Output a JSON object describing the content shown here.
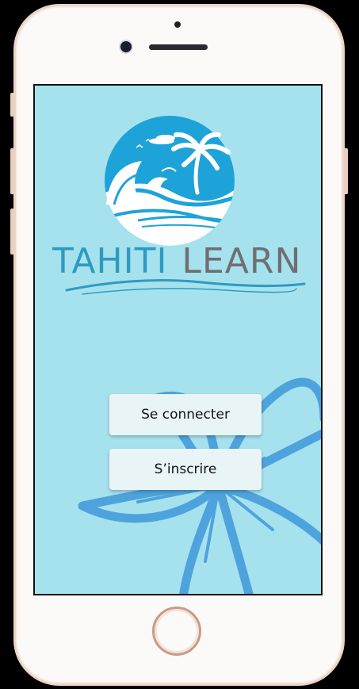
{
  "app": {
    "brand_part1": "TAHITI",
    "brand_part2": "LEARN"
  },
  "buttons": {
    "login_label": "Se connecter",
    "signup_label": "S’inscrire"
  },
  "icons": {
    "logo": "island-sea-logo-icon",
    "background": "tiare-flower-icon",
    "home": "home-button-icon"
  },
  "colors": {
    "screen_bg": "#a6e2ee",
    "brand_blue": "#2d9bc0",
    "brand_gray": "#6f6f73",
    "flower_blue": "#4ea3dc",
    "button_bg": "#e9f4f6"
  }
}
